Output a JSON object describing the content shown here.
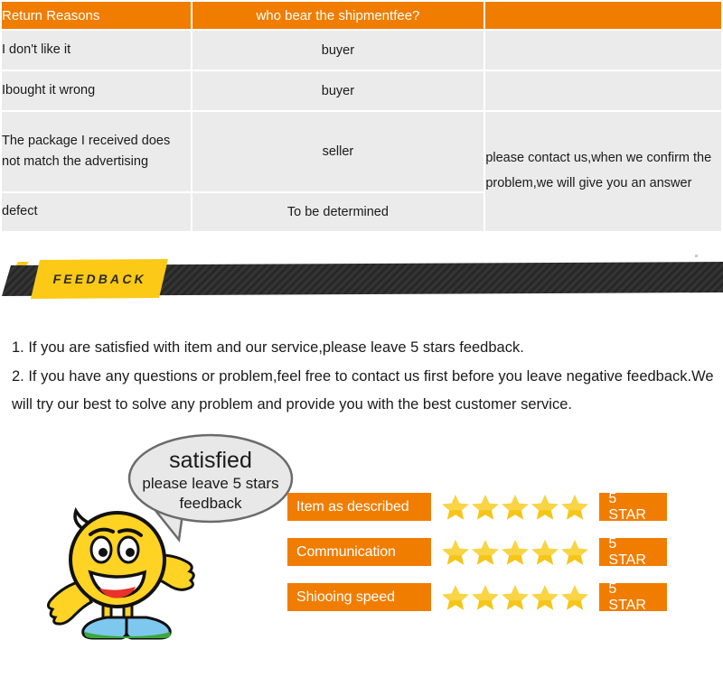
{
  "return_table": {
    "headers": [
      "Return Reasons",
      "who bear the shipmentfee?",
      ""
    ],
    "rows": [
      {
        "reason": "I don't like it",
        "fee": "buyer",
        "note": ""
      },
      {
        "reason": "Ibought it wrong",
        "fee": "buyer",
        "note": ""
      },
      {
        "reason": "The package I received does not match the advertising",
        "fee": "seller",
        "note": "please contact us,when we confirm the problem,we will give you an answer"
      },
      {
        "reason": "defect",
        "fee": "To be determined",
        "note": ""
      }
    ],
    "header_bg": "#f07d00",
    "cell_bg": "#ebebeb"
  },
  "banner": {
    "label": "FEEDBACK",
    "tag_color": "#fbc916",
    "bar_color": "#353535"
  },
  "instructions": {
    "line1": "1. If you are satisfied with item and our service,please leave 5 stars feedback.",
    "line2": "2. If you have any questions or problem,feel free to contact us first before you leave negative feedback.We will try our best to solve any problem and provide you with the best customer service."
  },
  "mascot": {
    "bubble_title": "satisfied",
    "bubble_line1": "please leave 5 stars",
    "bubble_line2": "feedback",
    "face_color": "#ffd324",
    "bubble_fill": "#e8e8e8",
    "shoe_color": "#7ec8f0"
  },
  "ratings": {
    "star_color": "#f5c518",
    "badge_color": "#f07d00",
    "rows": [
      {
        "label": "Item as described",
        "stars": 5,
        "badge": "5 STAR"
      },
      {
        "label": "Communication",
        "stars": 5,
        "badge": "5 STAR"
      },
      {
        "label": "Shiooing speed",
        "stars": 5,
        "badge": "5 STAR"
      }
    ]
  }
}
